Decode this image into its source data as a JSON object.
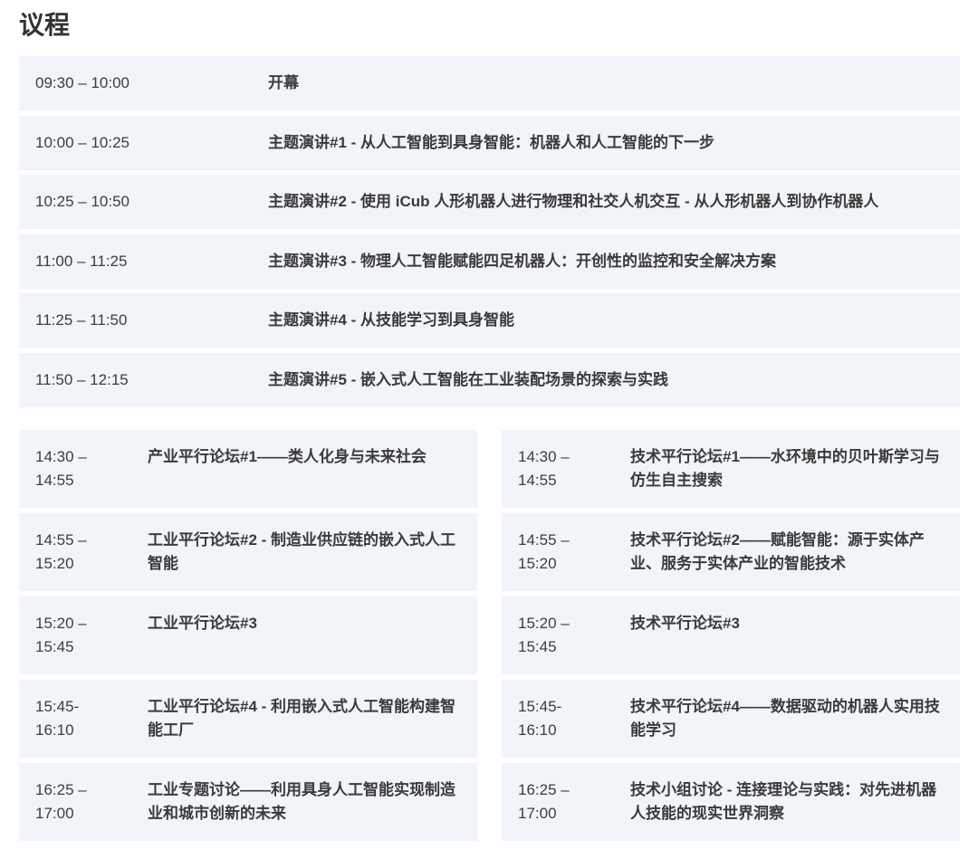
{
  "page": {
    "title": "议程"
  },
  "morning": [
    {
      "time": "09:30 – 10:00",
      "title": "开幕"
    },
    {
      "time": "10:00 – 10:25",
      "title": "主题演讲#1 - 从人工智能到具身智能：机器人和人工智能的下一步"
    },
    {
      "time": "10:25 – 10:50",
      "title": "主题演讲#2 - 使用 iCub 人形机器人进行物理和社交人机交互 - 从人形机器人到协作机器人"
    },
    {
      "time": "11:00 – 11:25",
      "title": "主题演讲#3 - 物理人工智能赋能四足机器人：开创性的监控和安全解决方案"
    },
    {
      "time": "11:25 – 11:50",
      "title": "主题演讲#4 - 从技能学习到具身智能"
    },
    {
      "time": "11:50 – 12:15",
      "title": "主题演讲#5 - 嵌入式人工智能在工业装配场景的探索与实践"
    }
  ],
  "afternoon": {
    "left": [
      {
        "time": "14:30 – 14:55",
        "title": "产业平行论坛#1——类人化身与未来社会"
      },
      {
        "time": "14:55 – 15:20",
        "title": "工业平行论坛#2 - 制造业供应链的嵌入式人工智能"
      },
      {
        "time": "15:20 – 15:45",
        "title": "工业平行论坛#3"
      },
      {
        "time": "15:45-16:10",
        "title": "工业平行论坛#4 - 利用嵌入式人工智能构建智能工厂"
      },
      {
        "time": "16:25 – 17:00",
        "title": "工业专题讨论——利用具身人工智能实现制造业和城市创新的未来"
      }
    ],
    "right": [
      {
        "time": "14:30 – 14:55",
        "title": "技术平行论坛#1——水环境中的贝叶斯学习与仿生自主搜索"
      },
      {
        "time": "14:55 – 15:20",
        "title": "技术平行论坛#2——赋能智能：源于实体产业、服务于实体产业的智能技术"
      },
      {
        "time": "15:20 – 15:45",
        "title": "技术平行论坛#3"
      },
      {
        "time": "15:45-16:10",
        "title": "技术平行论坛#4——数据驱动的机器人实用技能学习"
      },
      {
        "time": "16:25 – 17:00",
        "title": "技术小组讨论 - 连接理论与实践：对先进机器人技能的现实世界洞察"
      }
    ]
  },
  "colors": {
    "row_background": "#f1f4f8",
    "text": "#3a3a3a",
    "heading": "#333333"
  }
}
